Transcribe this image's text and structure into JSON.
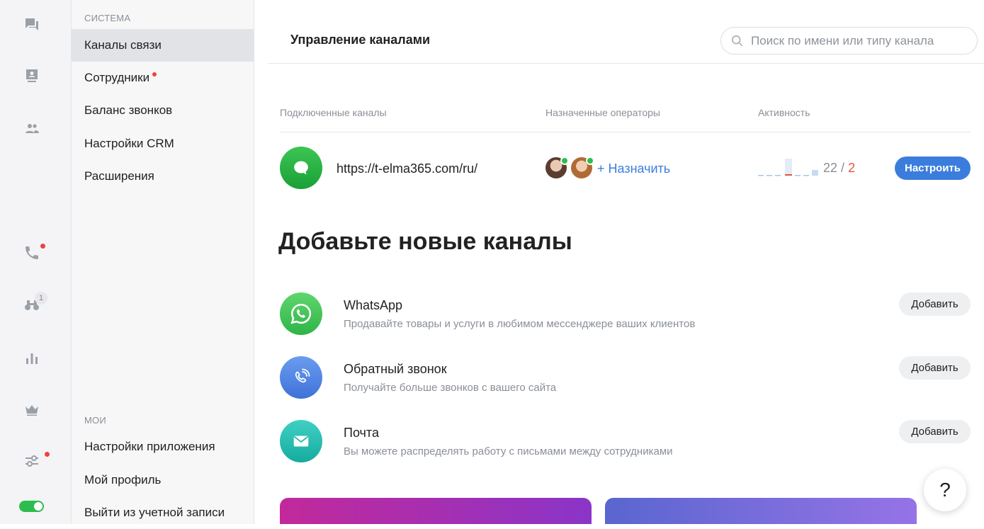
{
  "rail": {
    "icons": [
      "chat-icon",
      "contact-card-icon",
      "people-icon",
      "phone-icon",
      "binoculars-icon",
      "bar-chart-icon",
      "crown-icon",
      "sliders-icon"
    ],
    "binoculars_badge": "1"
  },
  "sidebar": {
    "section_system": "СИСТЕМА",
    "items": [
      {
        "label": "Каналы связи"
      },
      {
        "label": "Сотрудники"
      },
      {
        "label": "Баланс звонков"
      },
      {
        "label": "Настройки CRM"
      },
      {
        "label": "Расширения"
      }
    ],
    "section_mine": "МОИ",
    "mine_items": [
      {
        "label": "Настройки приложения"
      },
      {
        "label": "Мой профиль"
      },
      {
        "label": "Выйти из учетной записи"
      }
    ]
  },
  "header": {
    "title": "Управление каналами",
    "search_placeholder": "Поиск по имени или типу канала"
  },
  "table": {
    "columns": [
      "Подключенные каналы",
      "Назначенные операторы",
      "Активность"
    ],
    "row": {
      "url": "https://t-elma365.com/ru/",
      "assign_label": "+ Назначить",
      "count_main": "22",
      "count_sep": "/",
      "count_alt": "2",
      "button": "Настроить"
    }
  },
  "add_section": {
    "title": "Добавьте новые каналы",
    "items": [
      {
        "name": "WhatsApp",
        "desc": "Продавайте товары и услуги в любимом мессенджере ваших клиентов",
        "button": "Добавить"
      },
      {
        "name": "Обратный звонок",
        "desc": "Получайте больше звонков с вашего сайта",
        "button": "Добавить"
      },
      {
        "name": "Почта",
        "desc": "Вы можете распределять работу с письмами между сотрудниками",
        "button": "Добавить"
      }
    ]
  },
  "help": "?",
  "colors": {
    "accent": "#3b7ddd",
    "online": "#2dbd4e",
    "alert": "#f04040",
    "whatsapp": "#3cc552",
    "callback": "#4f86e8",
    "mail": "#1fbcb0"
  }
}
